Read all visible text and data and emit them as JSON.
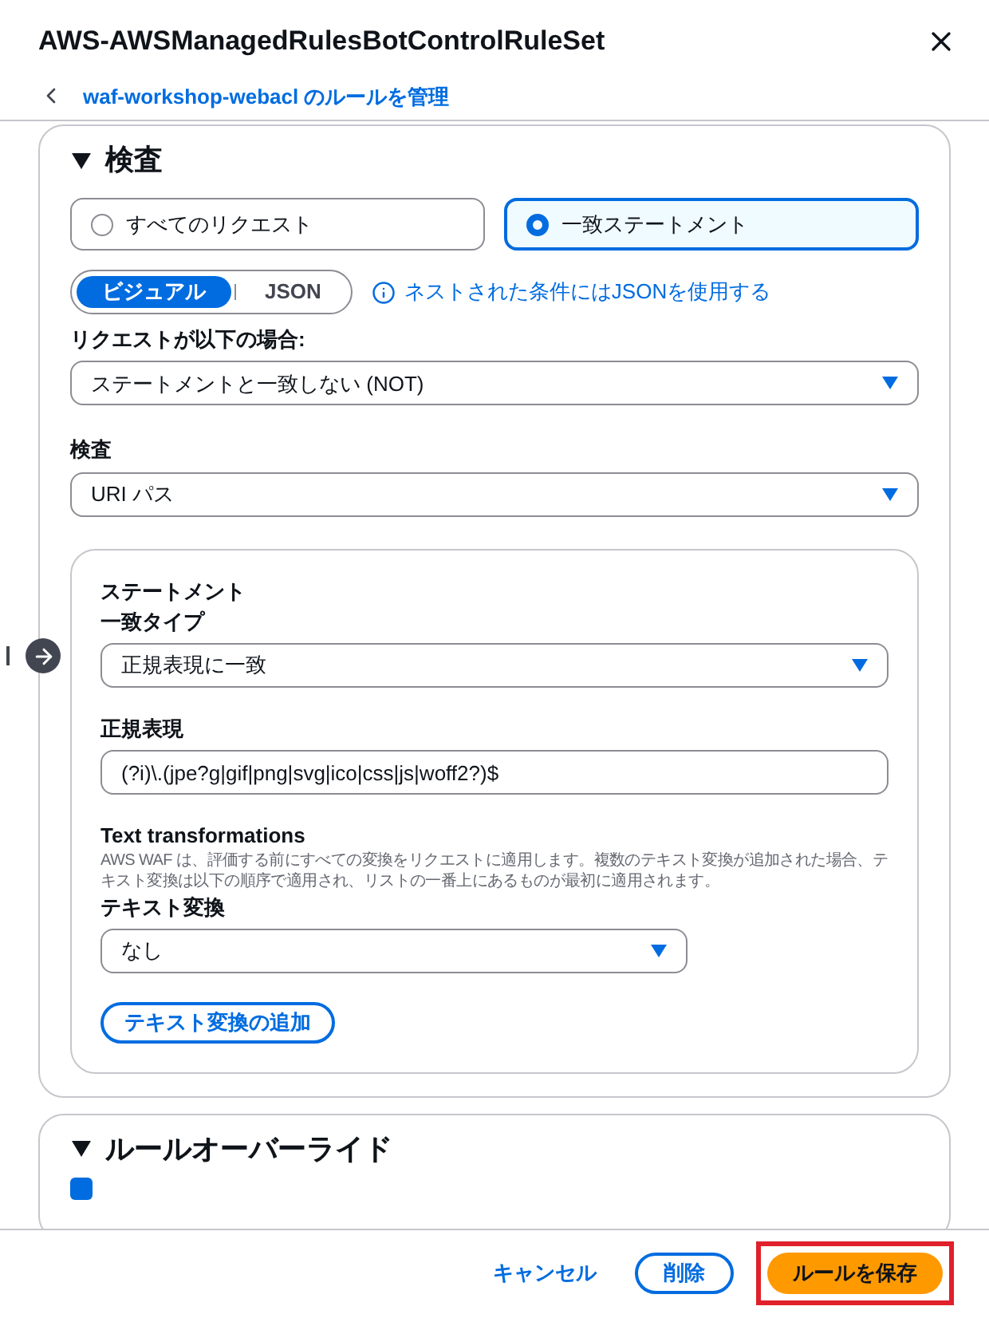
{
  "header": {
    "title": "AWS-AWSManagedRulesBotControlRuleSet",
    "back_link": "waf-workshop-webacl のルールを管理"
  },
  "inspection": {
    "heading": "検査",
    "expanded": true,
    "scope_options": [
      {
        "label": "すべてのリクエスト",
        "selected": false
      },
      {
        "label": "一致ステートメント",
        "selected": true
      }
    ],
    "editor_modes": [
      {
        "label": "ビジュアル",
        "selected": true
      },
      {
        "label": "JSON",
        "selected": false
      }
    ],
    "info_link": "ネストされた条件にはJSONを使用する",
    "condition": {
      "label": "リクエストが以下の場合:",
      "value": "ステートメントと一致しない (NOT)"
    },
    "inspect": {
      "label": "検査",
      "value": "URI パス"
    },
    "statement": {
      "title": "ステートメント",
      "match_type": {
        "label": "一致タイプ",
        "value": "正規表現に一致"
      },
      "regex": {
        "label": "正規表現",
        "value": "(?i)\\.(jpe?g|gif|png|svg|ico|css|js|woff2?)$"
      },
      "text_transformations": {
        "title": "Text transformations",
        "description": "AWS WAF は、評価する前にすべての変換をリクエストに適用します。複数のテキスト変換が追加された場合、テキスト変換は以下の順序で適用され、リストの一番上にあるものが最初に適用されます。",
        "label": "テキスト変換",
        "value": "なし",
        "add_button": "テキスト変換の追加"
      }
    }
  },
  "rule_override": {
    "heading": "ルールオーバーライド",
    "expanded": true,
    "override_checkbox": {
      "checked": true
    }
  },
  "footer": {
    "buttons": [
      {
        "label": "キャンセル",
        "kind": "link",
        "highlighted": false
      },
      {
        "label": "削除",
        "kind": "outline",
        "highlighted": false
      },
      {
        "label": "ルールを保存",
        "kind": "primary",
        "highlighted": true
      }
    ]
  }
}
